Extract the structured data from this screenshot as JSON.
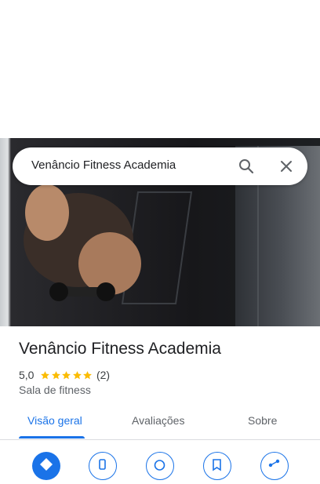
{
  "search": {
    "query": "Venâncio Fitness Academia"
  },
  "place": {
    "name": "Venâncio Fitness Academia",
    "rating": "5,0",
    "stars": 5,
    "review_count": "(2)",
    "category": "Sala de fitness"
  },
  "tabs": [
    {
      "label": "Visão geral",
      "active": true
    },
    {
      "label": "Avaliações",
      "active": false
    },
    {
      "label": "Sobre",
      "active": false
    }
  ],
  "actions": [
    {
      "icon": "directions-icon"
    },
    {
      "icon": "phone-icon"
    },
    {
      "icon": "website-icon"
    },
    {
      "icon": "save-icon"
    },
    {
      "icon": "share-icon"
    }
  ],
  "colors": {
    "accent": "#1a73e8",
    "star": "#fbbc04",
    "text": "#202124",
    "muted": "#5f6368"
  }
}
